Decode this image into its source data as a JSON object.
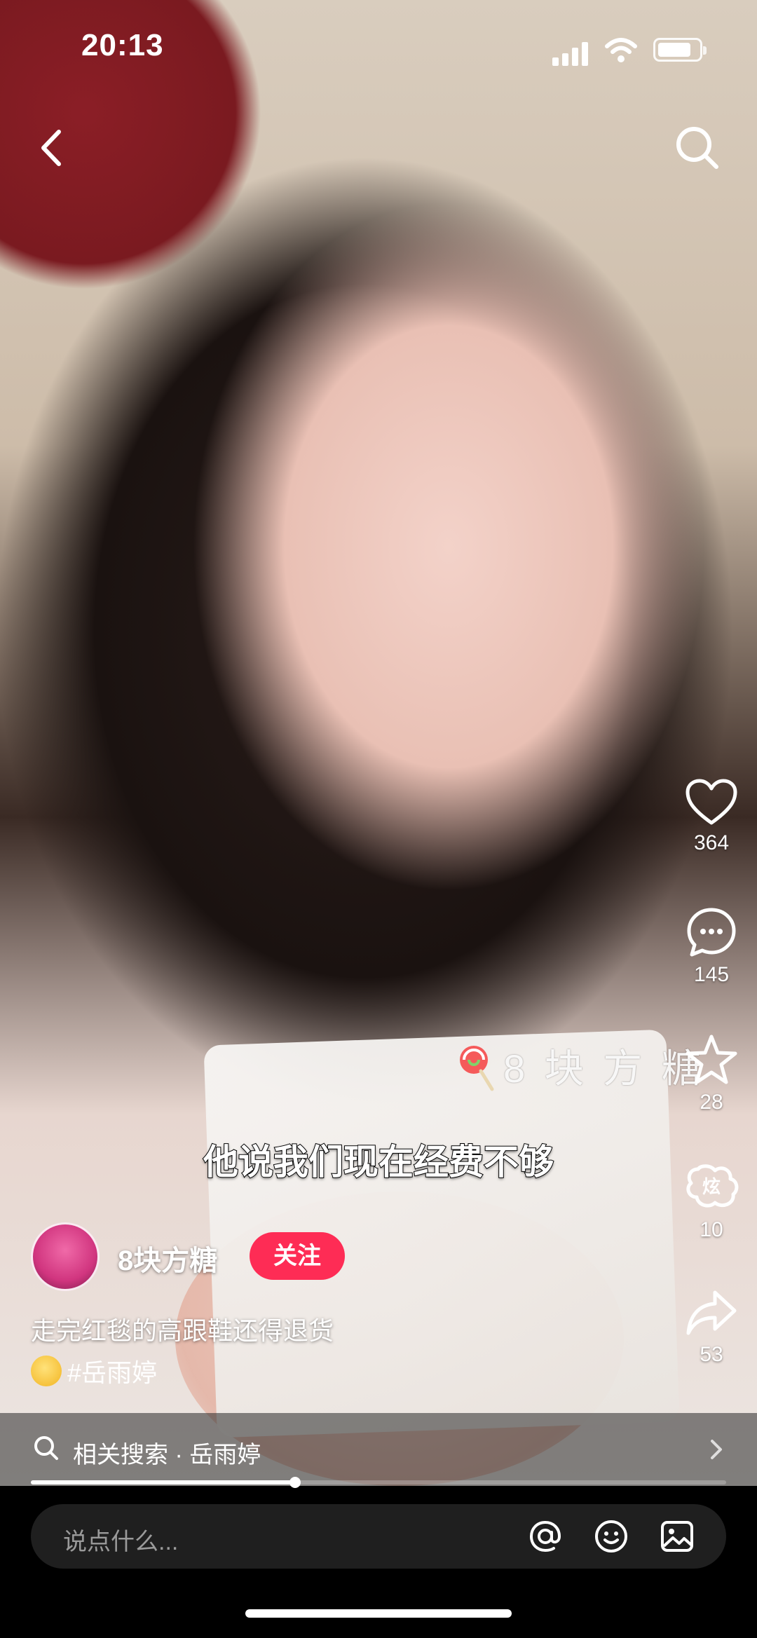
{
  "status_bar": {
    "time": "20:13"
  },
  "overlay": {
    "watermark": "8 块 方 糖",
    "subtitle": "他说我们现在经费不够"
  },
  "actions": [
    {
      "icon": "heart-icon",
      "count": "364"
    },
    {
      "icon": "comment-icon",
      "count": "145"
    },
    {
      "icon": "star-icon",
      "count": "28"
    },
    {
      "icon": "dazzle-icon",
      "count": "10"
    },
    {
      "icon": "share-icon",
      "count": "53"
    }
  ],
  "author": {
    "name": "8块方糖",
    "follow_label": "关注"
  },
  "post": {
    "caption": "走完红毯的高跟鞋还得退货",
    "hashtag": "#岳雨婷"
  },
  "related_search": {
    "label": "相关搜索 · 岳雨婷"
  },
  "playback": {
    "progress": 0.38
  },
  "comment_input": {
    "placeholder": "说点什么..."
  },
  "colors": {
    "follow": "#fe2c55"
  }
}
